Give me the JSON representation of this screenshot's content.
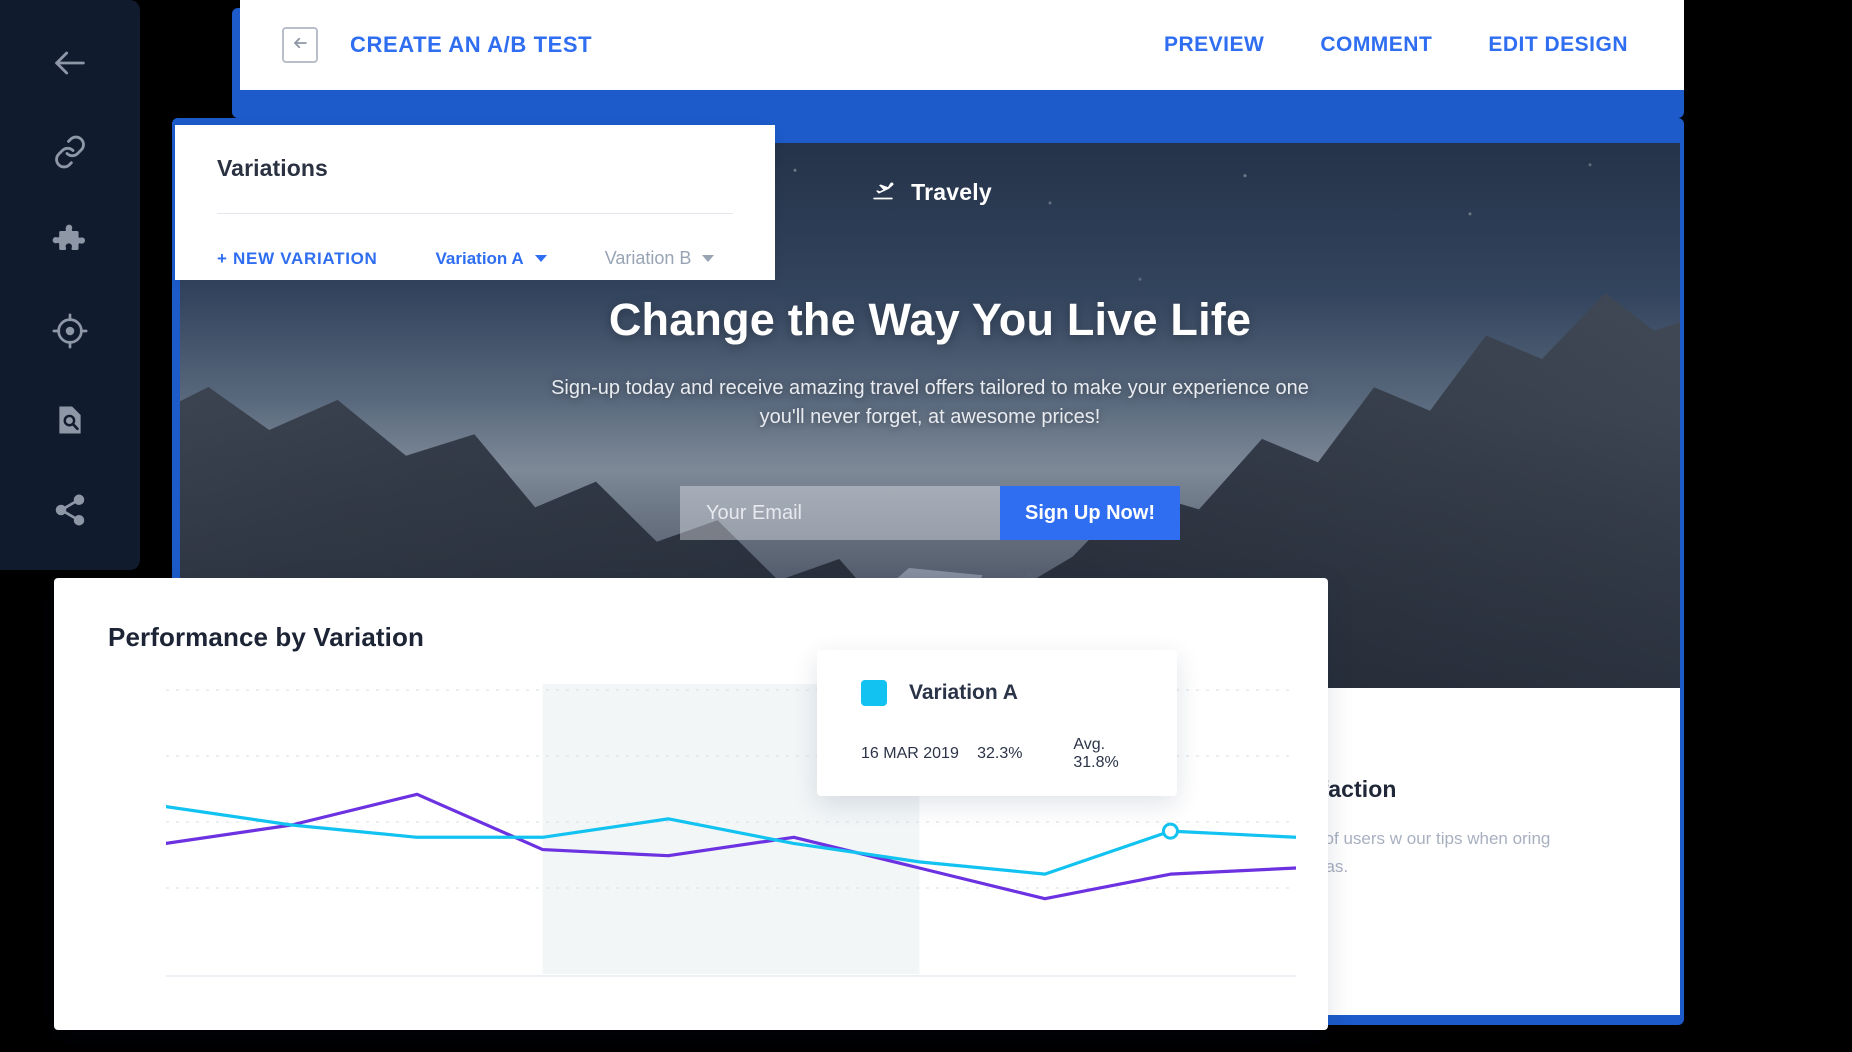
{
  "sidebar": {
    "items": [
      {
        "icon": "back-arrow-icon",
        "name": "sidebar-item-back"
      },
      {
        "icon": "link-icon",
        "name": "sidebar-item-link"
      },
      {
        "icon": "puzzle-icon",
        "name": "sidebar-item-integrations"
      },
      {
        "icon": "target-icon",
        "name": "sidebar-item-goals"
      },
      {
        "icon": "document-search-icon",
        "name": "sidebar-item-audit"
      },
      {
        "icon": "share-icon",
        "name": "sidebar-item-share"
      }
    ]
  },
  "header": {
    "back_icon": "back-to-panel-icon",
    "title": "CREATE AN A/B TEST",
    "actions": [
      {
        "label": "PREVIEW",
        "name": "preview"
      },
      {
        "label": "COMMENT",
        "name": "comment"
      },
      {
        "label": "EDIT DESIGN",
        "name": "edit-design"
      }
    ]
  },
  "variations": {
    "title": "Variations",
    "new_label": "+ NEW VARIATION",
    "tabs": [
      {
        "label": "Variation A",
        "active": true
      },
      {
        "label": "Variation B",
        "active": false
      }
    ]
  },
  "landing": {
    "brand": "Travely",
    "brand_icon": "airplane-takeoff-icon",
    "heading": "Change the Way You Live Life",
    "subheading": "Sign-up today and receive amazing travel offers tailored to make your experience one you'll never forget, at awesome prices!",
    "email_placeholder": "Your Email",
    "email_value": "",
    "cta_label": "Sign Up Now!",
    "section_title": "Satisfaction",
    "section_body": "usands of users\nw our tips when\noring new areas."
  },
  "chart_card": {
    "title": "Performance by Variation"
  },
  "tooltip": {
    "series_label": "Variation A",
    "swatch_color": "#12c2f0",
    "date": "16 MAR 2019",
    "value": "32.3%",
    "average": "Avg. 31.8%"
  },
  "colors": {
    "accent_blue": "#2f6ef0",
    "panel_blue": "#1c5bc9",
    "sidebar_navy": "#111b2e",
    "series_a_cyan": "#12c2f0",
    "series_b_purple": "#6c31e0"
  },
  "chart_data": {
    "type": "line",
    "title": "Performance by Variation",
    "xlabel": "",
    "ylabel": "",
    "ylim": [
      0,
      100
    ],
    "grid": true,
    "gridlines": 4,
    "legend": "tooltip",
    "highlight_band": {
      "from_index": 3,
      "to_index": 6
    },
    "highlight_point": {
      "series": "Variation A",
      "index": 8,
      "date": "16 MAR 2019",
      "value": 32.3
    },
    "x": [
      1,
      2,
      3,
      4,
      5,
      6,
      7,
      8,
      9,
      10
    ],
    "series": [
      {
        "name": "Variation A",
        "color": "#12c2f0",
        "values": [
          36,
          33,
          31,
          31,
          34,
          30,
          27,
          25,
          32,
          31
        ]
      },
      {
        "name": "Variation B",
        "color": "#6c31e0",
        "values": [
          30,
          33,
          38,
          29,
          28,
          31,
          26,
          21,
          25,
          26
        ]
      }
    ]
  }
}
